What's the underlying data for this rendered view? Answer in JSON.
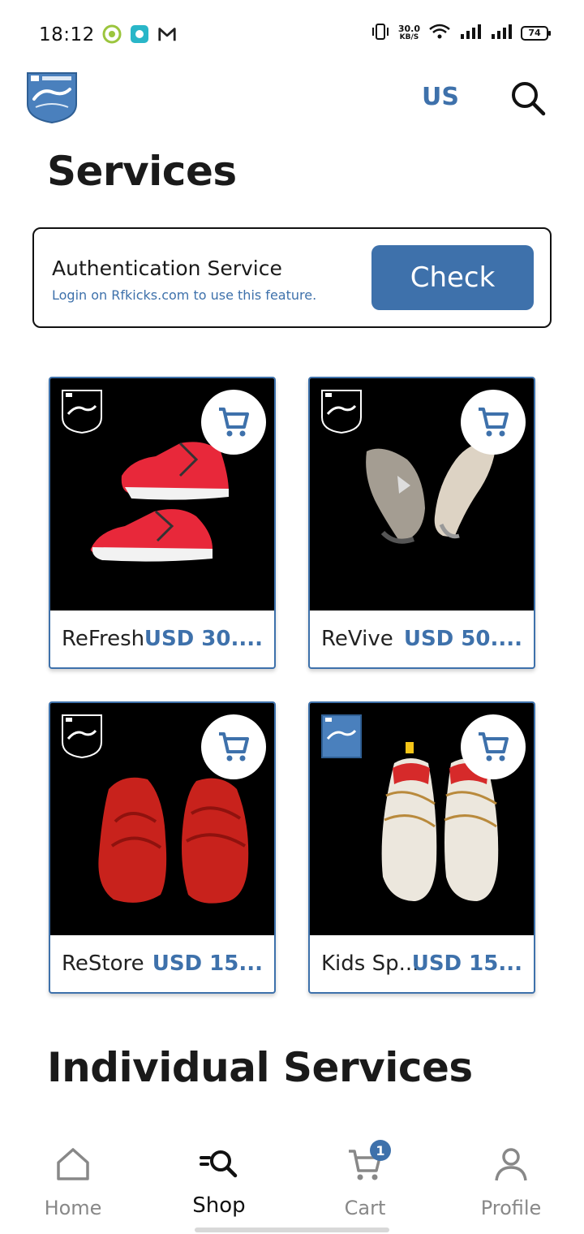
{
  "status_bar": {
    "time": "18:12",
    "net_speed_value": "30.0",
    "net_speed_unit": "KB/S",
    "battery": "74",
    "icons": [
      "chrome-icon",
      "app-icon",
      "gmail-icon",
      "vibrate-icon",
      "wifi-icon",
      "signal-icon",
      "signal-icon-2"
    ]
  },
  "header": {
    "logo_name": "Refresh Kicks",
    "region": "US",
    "search_icon": "search-icon"
  },
  "page_title": "Services",
  "auth_card": {
    "title": "Authentication Service",
    "subtitle": "Login on Rfkicks.com to use this feature.",
    "button_label": "Check"
  },
  "products": [
    {
      "name": "ReFresh",
      "price": "USD 30...."
    },
    {
      "name": "ReVive",
      "price": "USD 50...."
    },
    {
      "name": "ReStore",
      "price": "USD 15..."
    },
    {
      "name": "Kids Sp...",
      "price": "USD 15..."
    }
  ],
  "section_title": "Individual Services",
  "bottom_nav": {
    "items": [
      {
        "label": "Home",
        "icon": "home-icon"
      },
      {
        "label": "Shop",
        "icon": "shop-search-icon",
        "active": true
      },
      {
        "label": "Cart",
        "icon": "cart-icon",
        "badge": "1"
      },
      {
        "label": "Profile",
        "icon": "profile-icon"
      }
    ]
  },
  "colors": {
    "accent": "#3e71ab",
    "text": "#1a1a1a",
    "muted": "#888888"
  }
}
